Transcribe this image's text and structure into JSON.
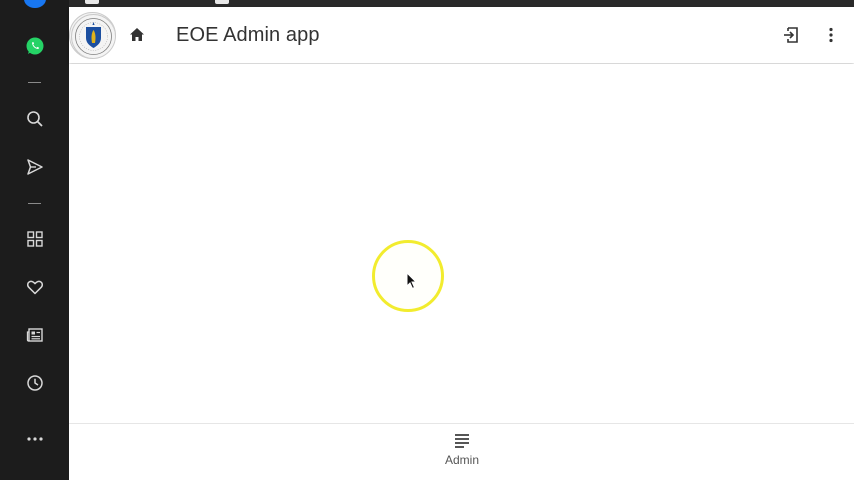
{
  "app": {
    "title": "EOE Admin app"
  },
  "header": {
    "home_icon": "home-icon",
    "logout_icon": "logout-icon",
    "more_icon": "more-vert-icon",
    "seal_icon": "massachusetts-seal-logo"
  },
  "bottom_nav": {
    "items": [
      {
        "label": "Admin",
        "icon": "notes-lines-icon"
      }
    ]
  },
  "sidebar": {
    "items": [
      {
        "icon": "messenger-icon"
      },
      {
        "icon": "whatsapp-icon"
      },
      {
        "icon": "search-icon"
      },
      {
        "icon": "send-icon"
      },
      {
        "icon": "grid-icon"
      },
      {
        "icon": "heart-icon"
      },
      {
        "icon": "news-icon"
      },
      {
        "icon": "history-clock-icon"
      },
      {
        "icon": "more-horizontal-icon"
      }
    ]
  },
  "colors": {
    "sidebar_bg": "#1c1c1c",
    "whatsapp_green": "#25d366",
    "messenger_blue": "#1877f2",
    "highlight_yellow": "#f2ec2e",
    "title_text": "#333333"
  }
}
